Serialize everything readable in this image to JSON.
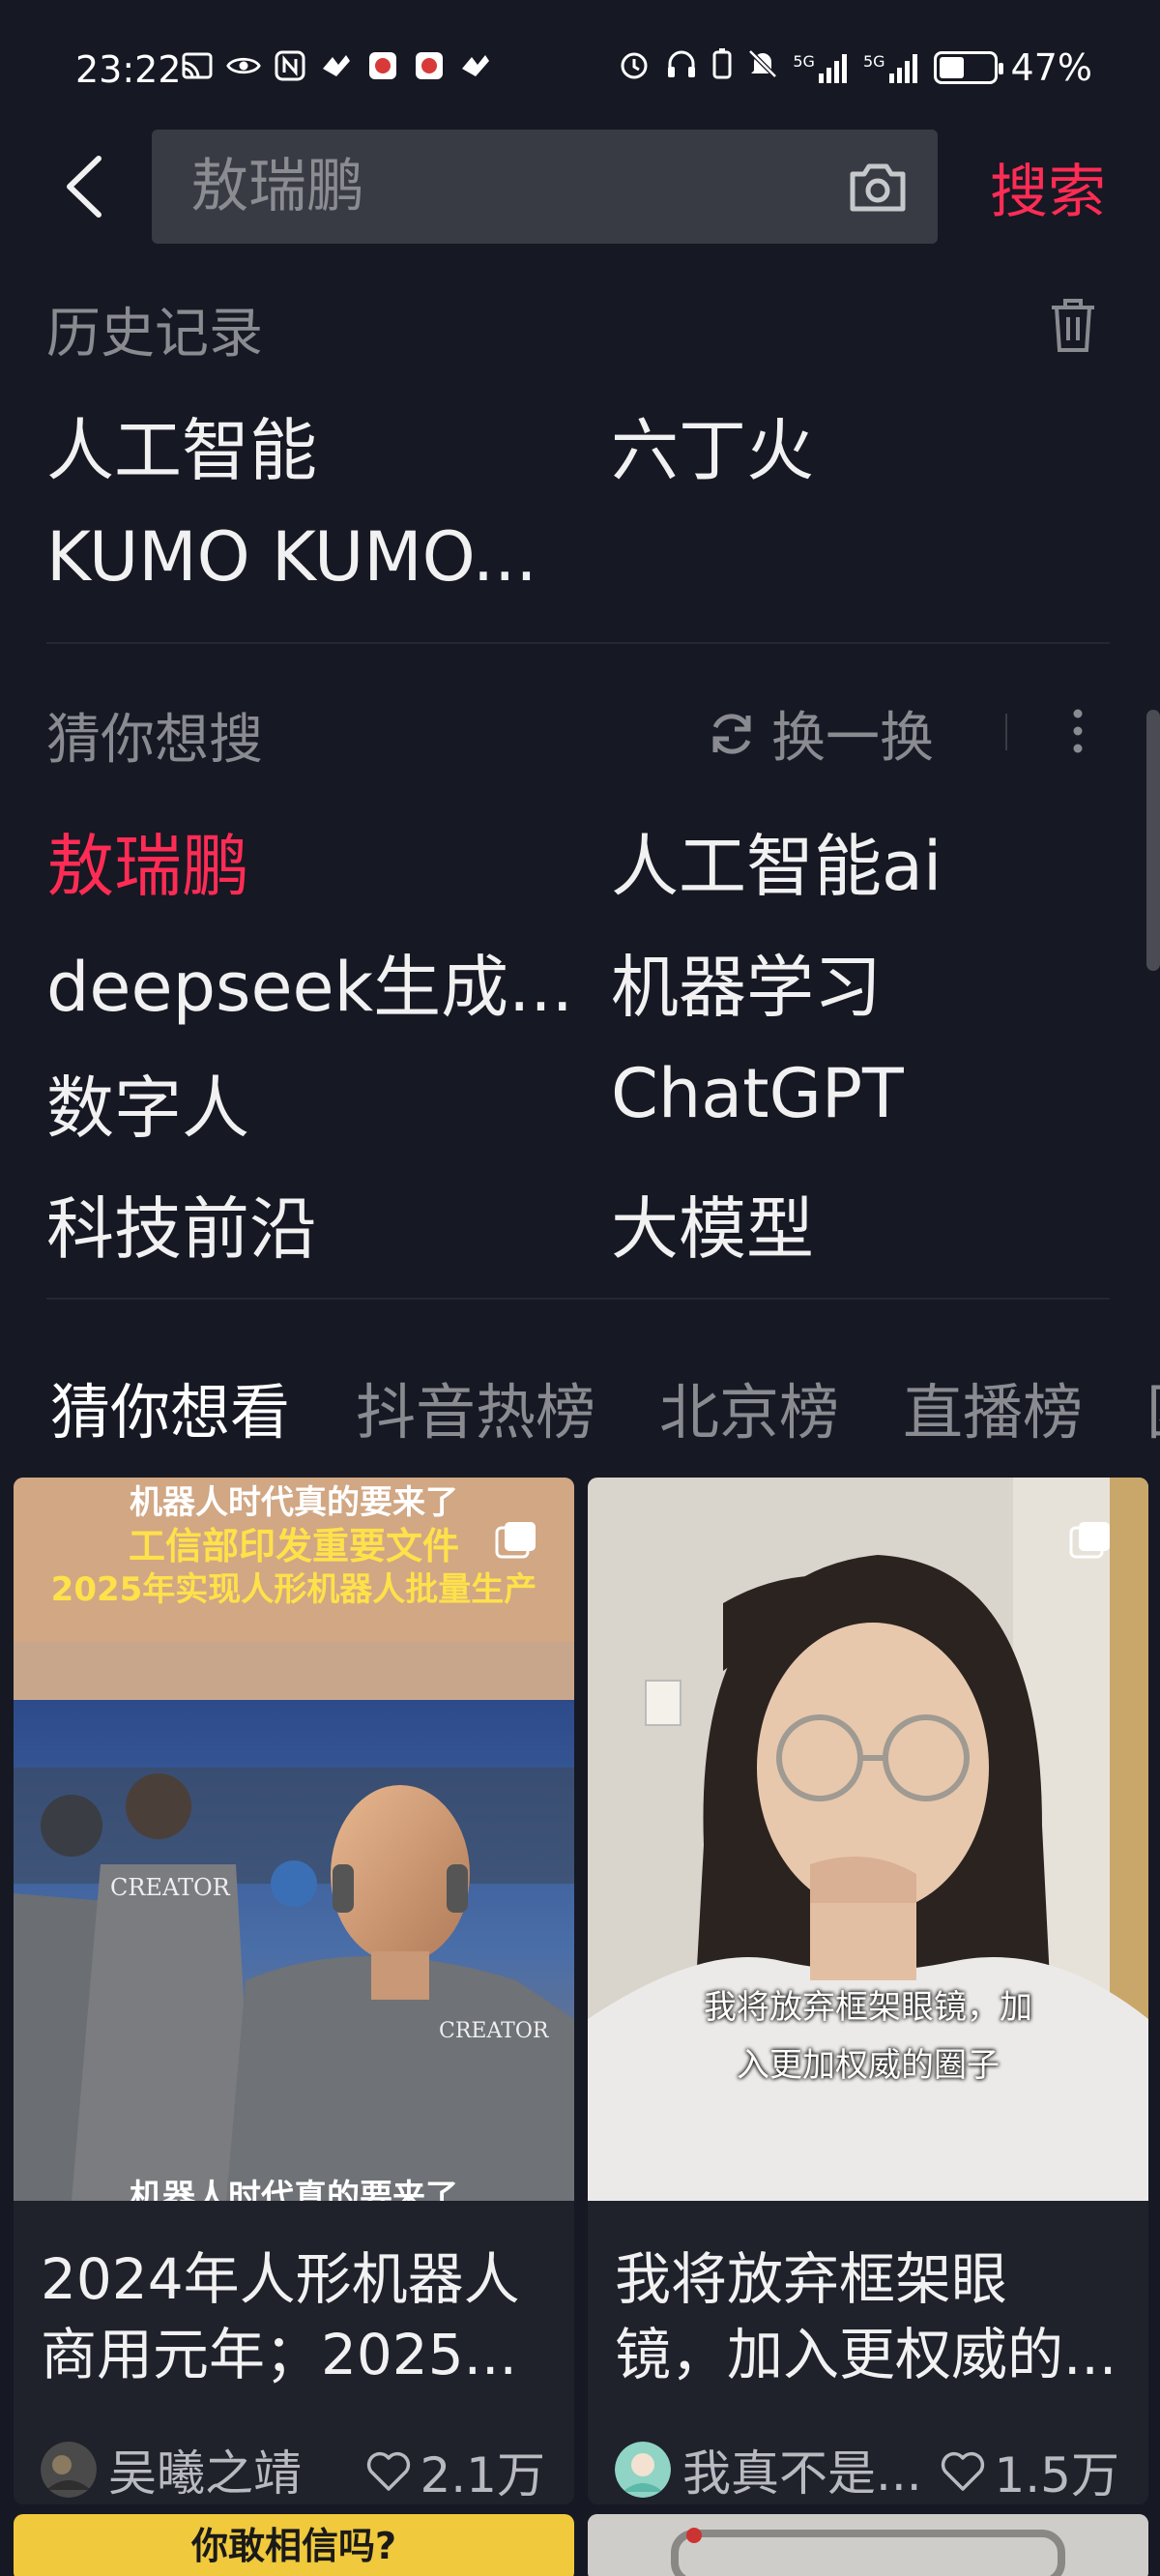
{
  "status_bar": {
    "time": "23:22",
    "battery_percent": "47%",
    "battery_level": 0.47,
    "network_1": "5G",
    "network_2": "5G"
  },
  "search": {
    "placeholder": "敖瑞鹏",
    "button_label": "搜索"
  },
  "history": {
    "title": "历史记录",
    "items": [
      "人工智能",
      "六丁火",
      "KUMO KUMO..."
    ]
  },
  "guess": {
    "title": "猜你想搜",
    "refresh_label": "换一换",
    "items": [
      "敖瑞鹏",
      "人工智能ai",
      "deepseek生成...",
      "机器学习",
      "数字人",
      "ChatGPT",
      "科技前沿",
      "大模型"
    ]
  },
  "tabs": [
    "猜你想看",
    "抖音热榜",
    "北京榜",
    "直播榜",
    "团"
  ],
  "cards": [
    {
      "title_line1": "2024年人形机器人",
      "title_line2": "商用元年；2025...",
      "author": "吴曦之靖",
      "likes": "2.1万",
      "thumb_caption_1": "机器人时代真的要来了",
      "thumb_caption_2": "工信部印发重要文件",
      "thumb_caption_3": "2025年实现人形机器人批量生产",
      "thumb_caption_4": "机器人时代真的要来了",
      "thumb_brand": "CREATOR"
    },
    {
      "title_line1": "我将放弃框架眼",
      "title_line2": "镜，加入更权威的...",
      "author": "我真不是...",
      "likes": "1.5万",
      "thumb_caption_1": "我将放弃框架眼镜，加",
      "thumb_caption_2": "入更加权威的圈子"
    }
  ],
  "peek_cards": [
    {
      "caption": "你敢相信吗?"
    }
  ],
  "colors": {
    "background": "#161823",
    "accent": "#fe2c55",
    "muted_text": "#8a8b91"
  }
}
